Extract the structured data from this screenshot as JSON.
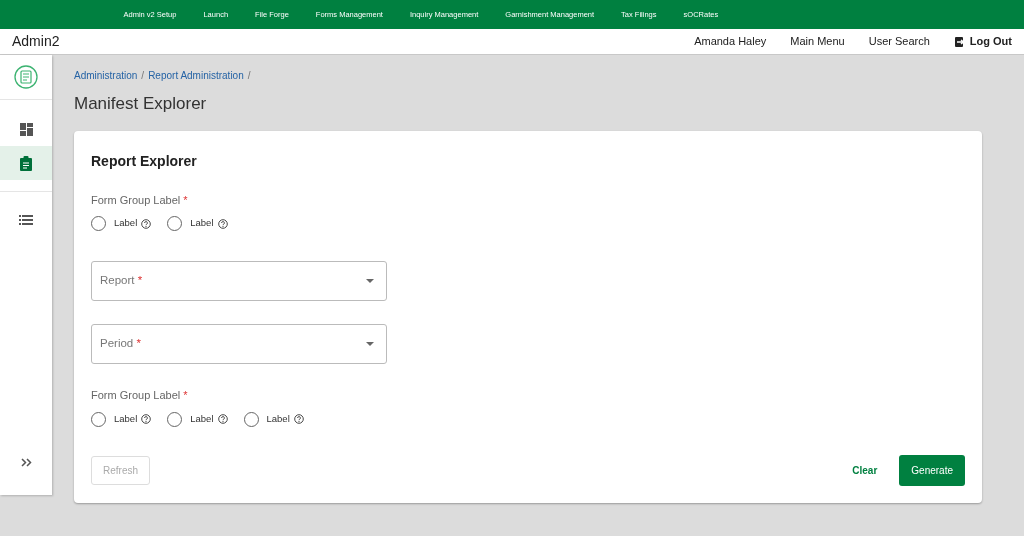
{
  "top_nav": [
    "Admin v2 Setup",
    "Launch",
    "File Forge",
    "Forms Management",
    "Inquiry Management",
    "Garnishment Management",
    "Tax Filings",
    "sOCRates"
  ],
  "header": {
    "app_title": "Admin2",
    "user_name": "Amanda Haley",
    "links": [
      "Main Menu",
      "User Search"
    ],
    "logout": "Log Out"
  },
  "sidebar": {
    "items": [
      {
        "kind": "dashboard",
        "selected": false
      },
      {
        "kind": "clipboard",
        "selected": true
      },
      {
        "kind": "list",
        "selected": false
      }
    ]
  },
  "breadcrumbs": [
    "Administration",
    "Report Administration"
  ],
  "breadcrumb_separator": "/",
  "page_title": "Manifest Explorer",
  "card": {
    "title": "Report Explorer",
    "fields": [
      {
        "kind": "radio_group",
        "label": "Form Group Label",
        "required_mark": "*",
        "options": [
          {
            "label": "Label",
            "selected": false
          },
          {
            "label": "Label",
            "selected": false
          }
        ]
      },
      {
        "kind": "select",
        "label": "Report",
        "required_mark": "*"
      },
      {
        "kind": "select",
        "label": "Period",
        "required_mark": "*"
      },
      {
        "kind": "radio_group",
        "label": "Form Group Label",
        "required_mark": "*",
        "options": [
          {
            "label": "Label",
            "selected": false
          },
          {
            "label": "Label",
            "selected": false
          },
          {
            "label": "Label",
            "selected": false
          }
        ]
      }
    ],
    "refresh": {
      "label": "Refresh",
      "disabled": true
    },
    "clear": "Clear",
    "generate": "Generate"
  }
}
